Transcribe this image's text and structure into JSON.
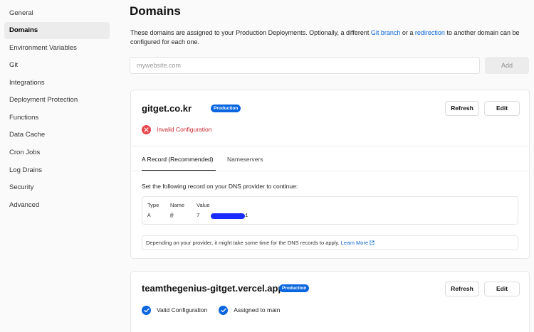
{
  "sidebar": {
    "items": [
      {
        "label": "General",
        "active": false
      },
      {
        "label": "Domains",
        "active": true
      },
      {
        "label": "Environment Variables",
        "active": false
      },
      {
        "label": "Git",
        "active": false
      },
      {
        "label": "Integrations",
        "active": false
      },
      {
        "label": "Deployment Protection",
        "active": false
      },
      {
        "label": "Functions",
        "active": false
      },
      {
        "label": "Data Cache",
        "active": false
      },
      {
        "label": "Cron Jobs",
        "active": false
      },
      {
        "label": "Log Drains",
        "active": false
      },
      {
        "label": "Security",
        "active": false
      },
      {
        "label": "Advanced",
        "active": false
      }
    ]
  },
  "header": {
    "title": "Domains",
    "desc_part1": "These domains are assigned to your Production Deployments. Optionally, a different ",
    "link_git_branch": "Git branch",
    "desc_part2": " or a ",
    "link_redirection": "redirection",
    "desc_part3": " to another domain can be configured for each one."
  },
  "add_domain": {
    "placeholder": "mywebsite.com",
    "button_label": "Add"
  },
  "domains": [
    {
      "name": "gitget.co.kr",
      "badge": "Production",
      "refresh_label": "Refresh",
      "edit_label": "Edit",
      "status": "Invalid Configuration",
      "tabs": [
        "A Record (Recommended)",
        "Nameservers"
      ],
      "instruction": "Set the following record on your DNS provider to continue:",
      "record": {
        "headers": [
          "Type",
          "Name",
          "Value"
        ],
        "type": "A",
        "name": "@",
        "value_start": "7",
        "value_end": "1"
      },
      "note": "Depending on your provider, it might take some time for the DNS records to apply.",
      "note_link": "Learn More"
    },
    {
      "name": "teamthegenius-gitget.vercel.app",
      "badge": "Production",
      "refresh_label": "Refresh",
      "edit_label": "Edit",
      "status": "Valid Configuration",
      "status2": "Assigned to main"
    }
  ],
  "colors": {
    "accent": "#0a66e0",
    "error": "#e5484d",
    "error_text": "#c9272d"
  }
}
